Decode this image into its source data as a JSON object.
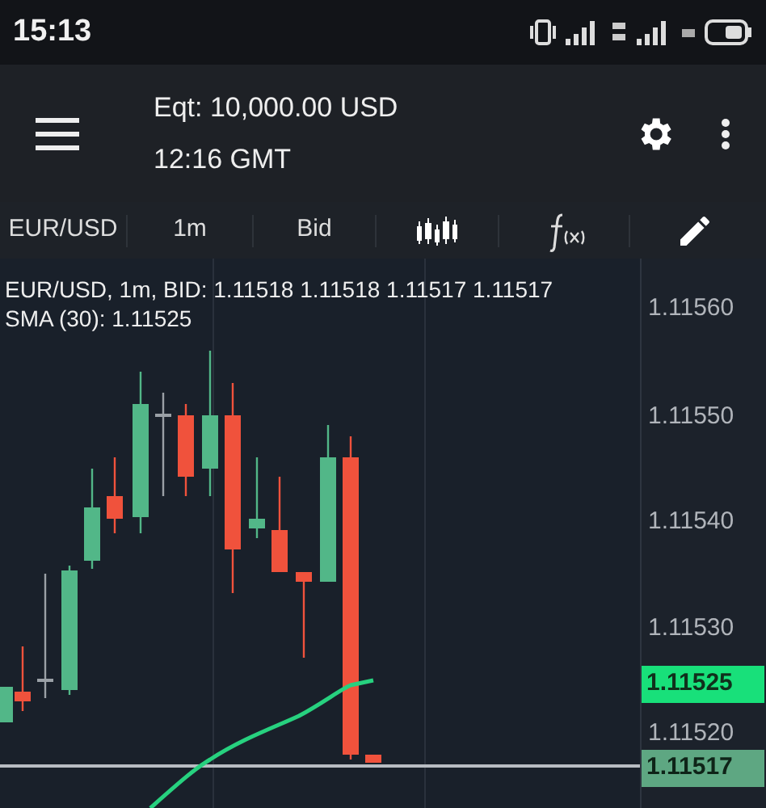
{
  "status_bar": {
    "time": "15:13"
  },
  "header": {
    "equity": "Eqt: 10,000.00 USD",
    "time": "12:16 GMT"
  },
  "toolbar": {
    "symbol": "EUR/USD",
    "timeframe": "1m",
    "price_type": "Bid"
  },
  "chart": {
    "legend": [
      "EUR/USD, 1m, BID: 1.11518 1.11518 1.11517 1.11517",
      "SMA (30): 1.11525"
    ],
    "price_axis": [
      "1.11560",
      "1.11550",
      "1.11540",
      "1.11530",
      "1.11520"
    ],
    "sma_tag": "1.11525",
    "last_price_tag": "1.11517"
  }
}
